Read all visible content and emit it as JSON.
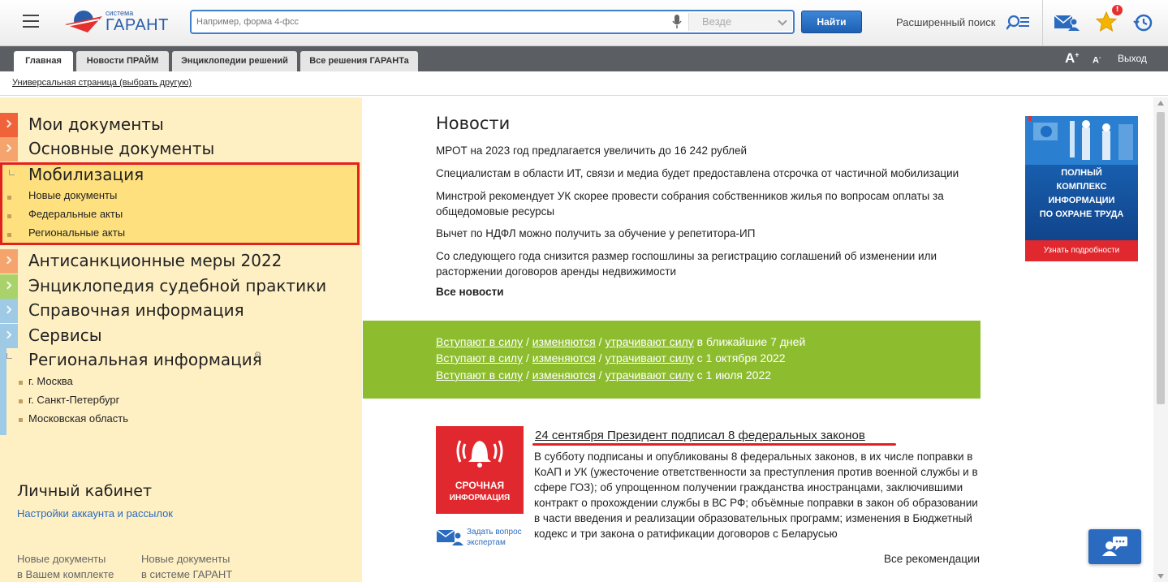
{
  "header": {
    "logo_small": "система",
    "logo_big": "ГАРАНТ",
    "search_placeholder": "Например, форма 4-фсс",
    "scope": "Везде",
    "find_label": "Найти",
    "adv_search_label": "Расширенный поиск",
    "star_badge": "!"
  },
  "tabs": [
    {
      "label": "Главная"
    },
    {
      "label": "Новости ПРАЙМ"
    },
    {
      "label": "Энциклопедии решений"
    },
    {
      "label": "Все решения ГАРАНТа"
    }
  ],
  "font_controls": {
    "plus": "A",
    "plus_sup": "+",
    "minus": "A",
    "minus_sup": "-"
  },
  "exit_label": "Выход",
  "universal_link": "Универсальная страница (выбрать другую)",
  "sidebar": {
    "items": [
      {
        "label": "Мои документы",
        "color": "#f0633a"
      },
      {
        "label": "Основные документы",
        "color": "#f5a46e"
      },
      {
        "label": "Мобилизация",
        "color": "#ffe07e"
      },
      {
        "label": "Антисанкционные меры 2022",
        "color": "#f5a46e"
      },
      {
        "label": "Энциклопедия судебной практики",
        "color": "#a9d36a"
      },
      {
        "label": "Справочная информация",
        "color": "#9ecae6"
      },
      {
        "label": "Сервисы",
        "color": "#9ecae6"
      },
      {
        "label": "Региональная информация",
        "color": "#9ecae6"
      }
    ],
    "mobilization_sub": [
      "Новые документы",
      "Федеральные акты",
      "Региональные акты"
    ],
    "regional_sub": [
      "г. Москва",
      "г. Санкт-Петербург",
      "Московская область"
    ],
    "lk_title": "Личный кабинет",
    "lk_link": "Настройки аккаунта и рассылок",
    "lk_col1": [
      "Новые документы",
      "в Вашем комплекте"
    ],
    "lk_col2": [
      "Новые документы",
      "в системе ГАРАНТ"
    ]
  },
  "news": {
    "title": "Новости",
    "items": [
      "МРОТ на 2023 год предлагается увеличить до 16 242 рублей",
      "Специалистам в области ИТ, связи и медиа будет предоставлена отсрочка от частичной мобилизации",
      "Минстрой рекомендует УК скорее провести собрания собственников жилья по вопросам оплаты за общедомовые ресурсы",
      "Вычет по НДФЛ можно получить за обучение у репетитора-ИП",
      "Со следующего года снизится размер госпошлины за регистрацию соглашений об изменении или расторжении договоров аренды недвижимости"
    ],
    "all_label": "Все новости"
  },
  "banner": {
    "lines": [
      "ПОЛНЫЙ",
      "КОМПЛЕКС",
      "ИНФОРМАЦИИ",
      "ПО ОХРАНЕ ТРУДА"
    ],
    "footer": "Узнать подробности"
  },
  "green_band": {
    "link1": "Вступают в силу",
    "link2": "изменяются",
    "link3": "утрачивают силу",
    "sep": " / ",
    "rows": [
      "в ближайшие 7 дней",
      "с 1 октября 2022",
      "с 1 июля 2022"
    ]
  },
  "article": {
    "badge_lines": [
      "СРОЧНАЯ",
      "ИНФОРМАЦИЯ"
    ],
    "ask_lines": [
      "Задать вопрос",
      "экспертам"
    ],
    "title": "24 сентября Президент подписал 8 федеральных законов",
    "body": "В субботу подписаны и опубликованы 8 федеральных законов, в их числе поправки в КоАП и УК (ужесточение ответственности за преступления против военной службы и в сфере ГОЗ); об упрощенном получении гражданства иностранцами, заключившими контракт о прохождении службы в ВС РФ; объёмные поправки в закон об образовании в части введения и реализации образовательных программ; изменения в Бюджетный кодекс и три закона о ратификации договоров с Беларусью",
    "all_recs": "Все рекомендации"
  },
  "colors": {
    "accent": "#2a6bbf",
    "highlight_border": "#e32020",
    "green": "#8dbd2e",
    "alert_red": "#e0282e"
  }
}
